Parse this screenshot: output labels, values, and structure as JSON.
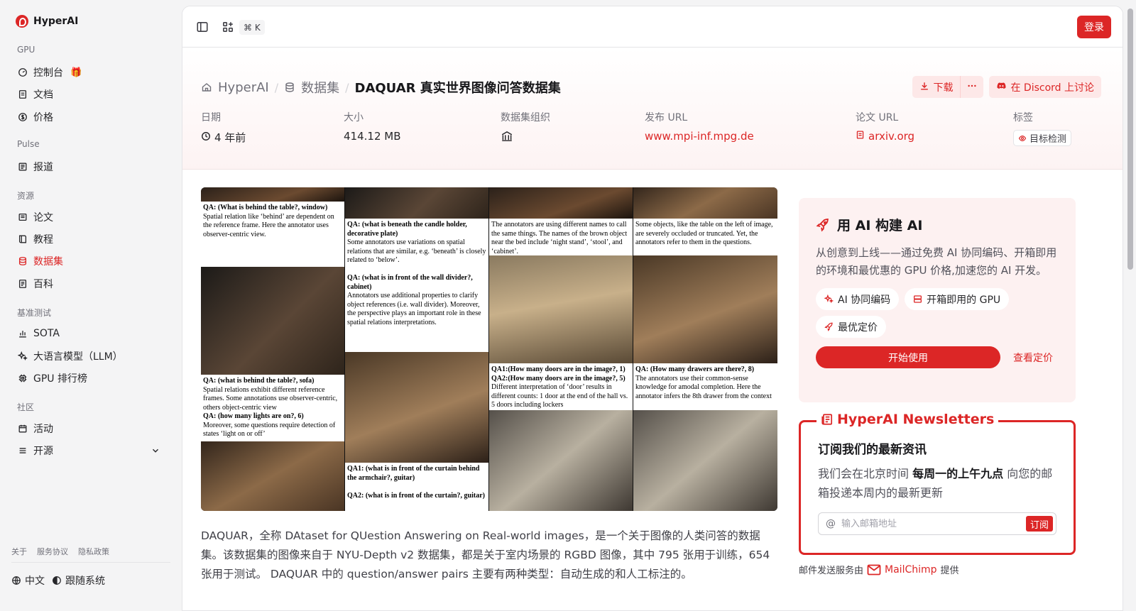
{
  "brand": {
    "name": "HyperAI"
  },
  "sidebar": {
    "sections": [
      {
        "label": "GPU"
      },
      {
        "label": "Pulse"
      },
      {
        "label": "资源"
      },
      {
        "label": "基准测试"
      },
      {
        "label": "社区"
      }
    ],
    "items": [
      {
        "label": "控制台",
        "icon": "gauge-icon"
      },
      {
        "label": "文档",
        "icon": "doc-icon"
      },
      {
        "label": "价格",
        "icon": "dollar-icon"
      },
      {
        "label": "报道",
        "icon": "news-icon"
      },
      {
        "label": "论文",
        "icon": "paper-icon"
      },
      {
        "label": "教程",
        "icon": "book-icon"
      },
      {
        "label": "数据集",
        "icon": "database-icon",
        "active": true
      },
      {
        "label": "百科",
        "icon": "wiki-icon"
      },
      {
        "label": "SOTA",
        "icon": "chart-icon"
      },
      {
        "label": "大语言模型（LLM）",
        "icon": "sparkle-icon"
      },
      {
        "label": "GPU 排行榜",
        "icon": "chip-icon"
      },
      {
        "label": "活动",
        "icon": "calendar-icon"
      },
      {
        "label": "开源",
        "icon": "list-icon"
      }
    ],
    "footer_links": [
      "关于",
      "服务协议",
      "隐私政策"
    ],
    "language": "中文",
    "theme": "跟随系统"
  },
  "topbar": {
    "shortcut": "⌘ K",
    "login": "登录"
  },
  "breadcrumb": {
    "home": "HyperAI",
    "section": "数据集",
    "current": "DAQUAR 真实世界图像问答数据集"
  },
  "actions": {
    "download": "下载",
    "discord": "在 Discord 上讨论"
  },
  "meta": {
    "date_label": "日期",
    "date_value": "4 年前",
    "size_label": "大小",
    "size_value": "414.12 MB",
    "org_label": "数据集组织",
    "url_label": "发布 URL",
    "url_value": "www.mpi-inf.mpg.de",
    "paper_label": "论文 URL",
    "paper_value": "arxiv.org",
    "tags_label": "标签",
    "tag_value": "目标检测"
  },
  "figure": {
    "captions": {
      "c1a_q": "QA: (What is behind the table?, window)",
      "c1a_t": "Spatial relation like ‘behind’ are dependent on the reference frame. Here the annotator uses observer-centric view.",
      "c1b_q": "QA: (what is behind the table?, sofa)",
      "c1b_t": "Spatial relations exhibit different reference frames. Some annotations use observer-centric, others object-centric view",
      "c1b_q2": "QA: (how many lights are on?, 6)",
      "c1b_t2": "Moreover, some questions require detection of states ‘light on or off’",
      "c2a_q": "QA: (what is beneath the candle holder, decorative plate)",
      "c2a_t": "Some annotators use variations on spatial relations that are similar, e.g. ‘beneath’ is closely related to ‘below’.",
      "c2a_q2": "QA: (what is in front of the wall divider?, cabinet)",
      "c2a_t2": "Annotators use additional properties to clarify object references  (i.e. wall divider). Moreover, the perspective plays an important role in these spatial relations interpretations.",
      "c2b_q": "QA1: (what is in front of the curtain behind the armchair?, guitar)",
      "c2b_q2": "QA2: (what is in front of the curtain?, guitar)",
      "c3a_t": "The annotators are using different names to call the same things. The names of the brown object near the bed include ‘night stand’, ‘stool’, and ‘cabinet’.",
      "c3b_q": "QA1:(How many doors are in the image?, 1)",
      "c3b_q2": "QA2:(How many doors are in the image?, 5)",
      "c3b_t": "Different interpretation of ‘door’ results in different counts: 1 door at the end of the hall vs. 5 doors including lockers",
      "c4a_t": "Some objects, like the table on the left of image, are severely occluded or truncated. Yet, the annotators refer to them in the questions.",
      "c4b_q": "QA: (How many drawers are there?, 8)",
      "c4b_t": "The annotators use their common-sense knowledge for amodal completion. Here the annotator infers the 8th drawer from the context"
    }
  },
  "description": "DAQUAR，全称 DAtaset for QUestion Answering on Real-world images，是一个关于图像的人类问答的数据集。该数据集的图像来自于 NYU-Depth v2 数据集，都是关于室内场景的 RGBD 图像，其中 795 张用于训练，654 张用于测试。 DAQUAR 中的 question/answer pairs 主要有两种类型：自动生成的和人工标注的。",
  "promo": {
    "title": "用 AI 构建 AI",
    "text": "从创意到上线——通过免费 AI 协同编码、开箱即用的环境和最优惠的 GPU 价格,加速您的 AI 开发。",
    "chips": [
      "AI 协同编码",
      "开箱即用的 GPU",
      "最优定价"
    ],
    "start": "开始使用",
    "pricing": "查看定价"
  },
  "newsletter": {
    "legend": "HyperAI Newsletters",
    "heading": "订阅我们的最新资讯",
    "text_a": "我们会在北京时间 ",
    "text_b": "每周一的上午九点",
    "text_c": " 向您的邮箱投递本周内的最新更新",
    "placeholder": "输入邮箱地址",
    "subscribe": "订阅",
    "provider_a": "邮件发送服务由",
    "provider_name": "MailChimp",
    "provider_b": "提供"
  }
}
